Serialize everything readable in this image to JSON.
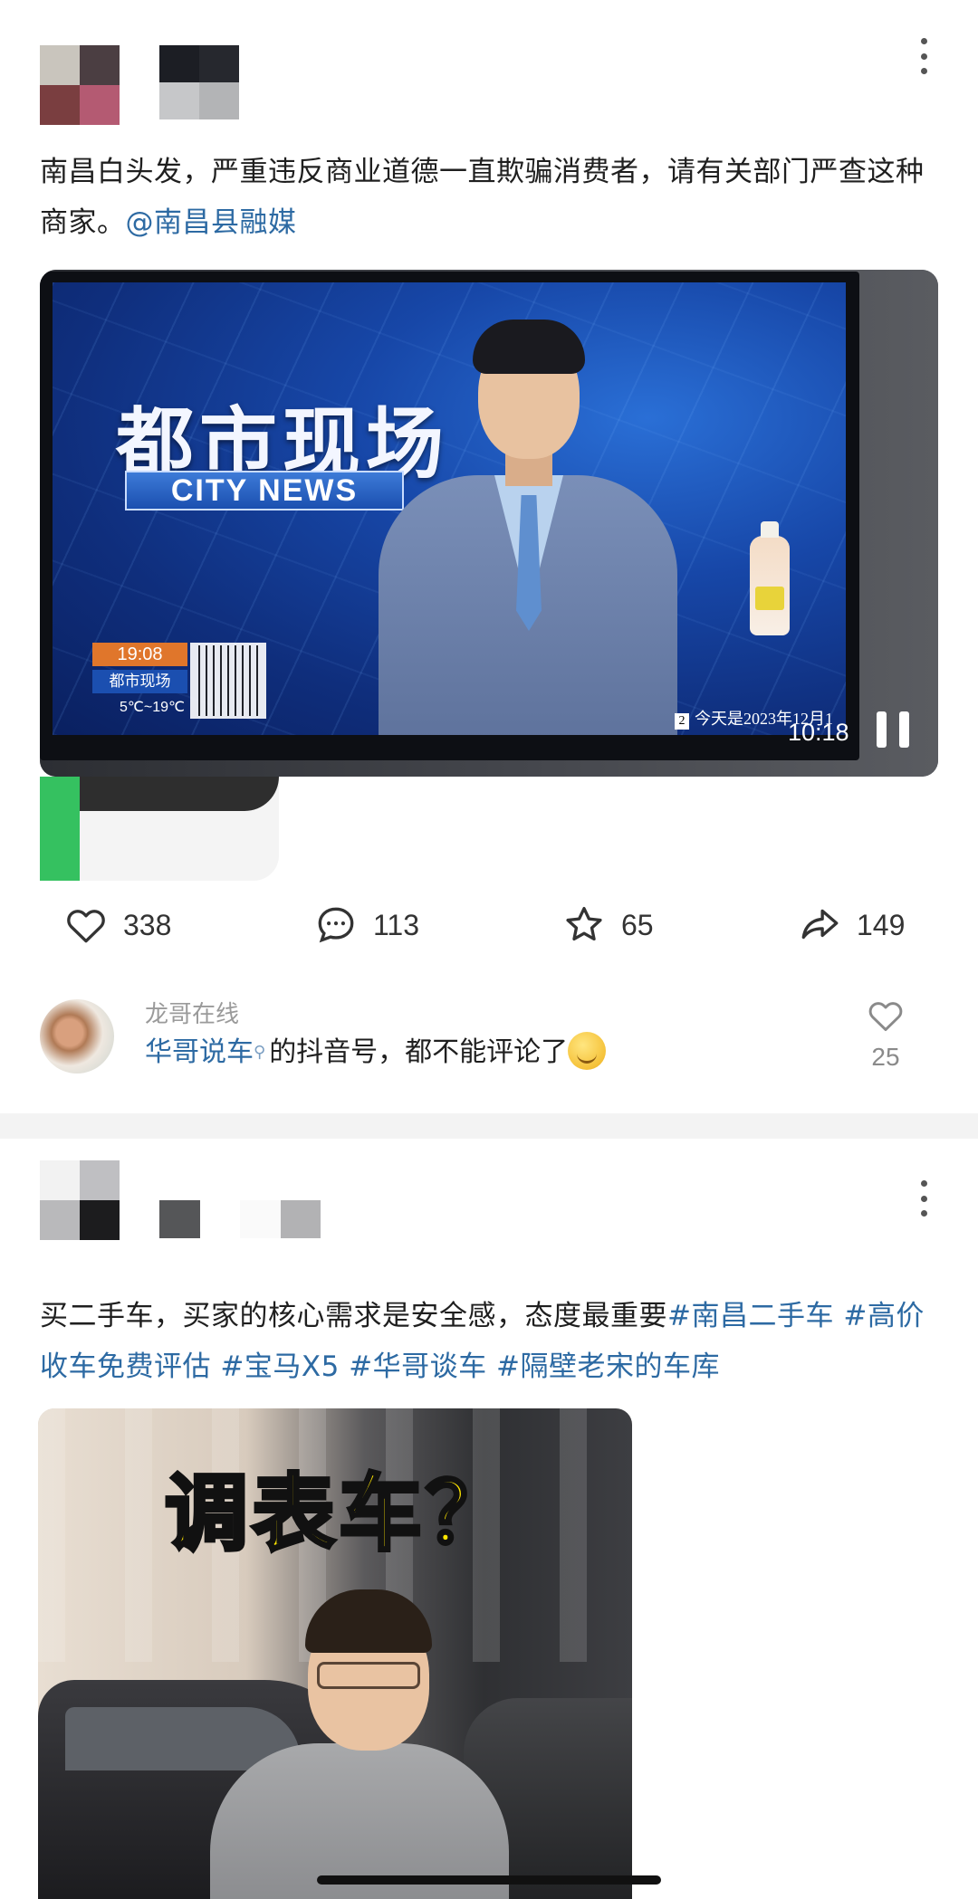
{
  "post1": {
    "text": "南昌白头发，严重违反商业道德一直欺骗消费者，请有关部门严查这种商家。",
    "mention": "@南昌县融媒",
    "media": {
      "show_title_cn": "都市现场",
      "show_title_en": "CITY NEWS",
      "clock_time": "19:08",
      "clock_show": "都市现场",
      "temperature": "5℃~19℃",
      "ticker_num": "2",
      "ticker": "今天是2023年12月1",
      "video_time": "10:18",
      "pause_icon": "pause-icon"
    },
    "actions": {
      "like_count": "338",
      "comment_count": "113",
      "favorite_count": "65",
      "share_count": "149"
    },
    "comment": {
      "author": "龙哥在线",
      "mention": "华哥说车",
      "text": "的抖音号，都不能评论了",
      "like_count": "25"
    }
  },
  "post2": {
    "text": "买二手车，买家的核心需求是安全感，态度最重要",
    "tags": [
      "#南昌二手车",
      "#高价收车免费评估",
      "#宝马X5",
      "#华哥谈车",
      "#隔壁老宋的车库"
    ],
    "media": {
      "overlay_title": "调表车？"
    }
  },
  "colors": {
    "link": "#2d6aa3",
    "background": "#ffffff",
    "divider": "#f3f3f3"
  }
}
